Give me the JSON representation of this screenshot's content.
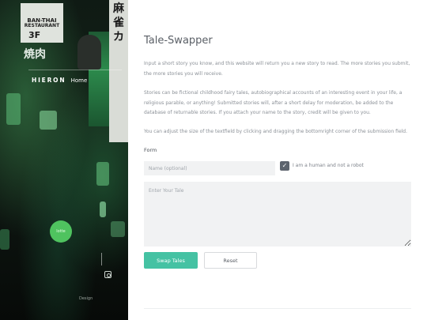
{
  "sidebar": {
    "brand_name": "HIERON",
    "brand_home": "Home",
    "sign_bantai_top": "BAN-THAI",
    "sign_bantai_bottom": "RESTAURANT",
    "sign_floor": "3F",
    "sign_kanji_left": "焼肉",
    "sign_kanji_right": "麻雀カ",
    "circle_sign": "lotte",
    "credit": "Design"
  },
  "main": {
    "title": "Tale-Swapper",
    "paragraphs": [
      "Input a short story you know, and this website will return you a new story to read. The more stories you submit, the more stories you will receive.",
      "Stories can be fictional childhood fairy tales, autobiographical accounts of an interesting event in your life, a religious parable, or anything! Submitted stories will, after a short delay for moderation, be added to the database of returnable stories. If you attach your name to the story, credit will be given to you.",
      "You can adjust the size of the textfield by clicking and dragging the bottomright corner of the submission field."
    ],
    "form": {
      "label": "Form",
      "name_placeholder": "Name (optional)",
      "name_value": "",
      "human_check_label": "I am a human and not a robot",
      "human_checked_glyph": "✓",
      "tale_placeholder": "Enter Your Tale",
      "swap_button": "Swap Tales",
      "reset_button": "Reset"
    }
  },
  "colors": {
    "accent": "#45c2a3",
    "checkbox": "#5d646e"
  },
  "icons": {
    "social": "instagram-icon",
    "check": "checkmark-icon"
  }
}
